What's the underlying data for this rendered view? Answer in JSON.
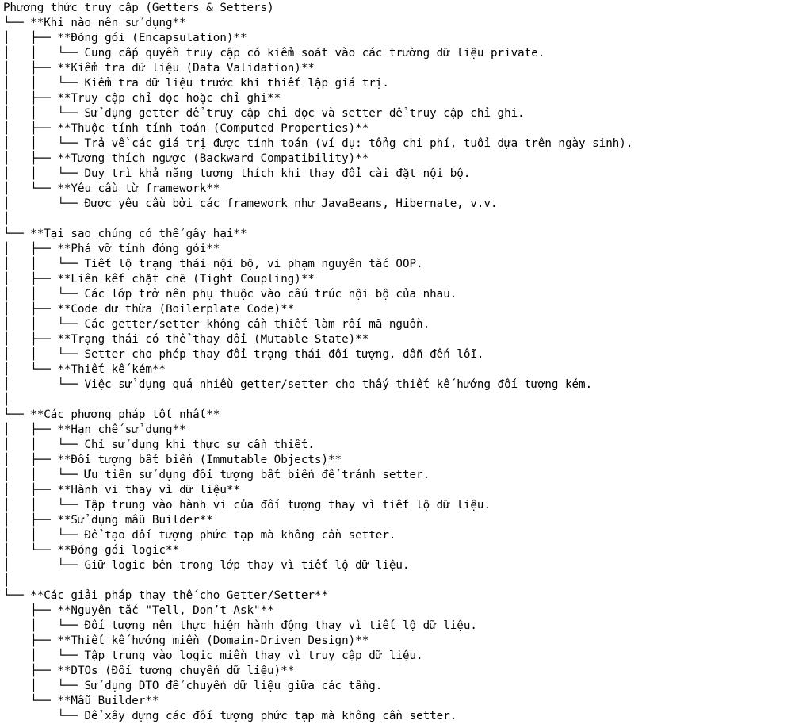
{
  "title": "Phương thức truy cập (Getters & Setters)",
  "sections": [
    {
      "heading": "**Khi nào nên sử dụng**",
      "items": [
        {
          "title": "**Đóng gói (Encapsulation)**",
          "detail": "Cung cấp quyền truy cập có kiểm soát vào các trường dữ liệu private."
        },
        {
          "title": "**Kiểm tra dữ liệu (Data Validation)**",
          "detail": "Kiểm tra dữ liệu trước khi thiết lập giá trị."
        },
        {
          "title": "**Truy cập chỉ đọc hoặc chỉ ghi**",
          "detail": "Sử dụng getter để truy cập chỉ đọc và setter để truy cập chỉ ghi."
        },
        {
          "title": "**Thuộc tính tính toán (Computed Properties)**",
          "detail": "Trả về các giá trị được tính toán (ví dụ: tổng chi phí, tuổi dựa trên ngày sinh)."
        },
        {
          "title": "**Tương thích ngược (Backward Compatibility)**",
          "detail": "Duy trì khả năng tương thích khi thay đổi cài đặt nội bộ."
        },
        {
          "title": "**Yêu cầu từ framework**",
          "detail": "Được yêu cầu bởi các framework như JavaBeans, Hibernate, v.v."
        }
      ]
    },
    {
      "heading": "**Tại sao chúng có thể gây hại**",
      "items": [
        {
          "title": "**Phá vỡ tính đóng gói**",
          "detail": "Tiết lộ trạng thái nội bộ, vi phạm nguyên tắc OOP."
        },
        {
          "title": "**Liên kết chặt chẽ (Tight Coupling)**",
          "detail": "Các lớp trở nên phụ thuộc vào cấu trúc nội bộ của nhau."
        },
        {
          "title": "**Code dư thừa (Boilerplate Code)**",
          "detail": "Các getter/setter không cần thiết làm rối mã nguồn."
        },
        {
          "title": "**Trạng thái có thể thay đổi (Mutable State)**",
          "detail": "Setter cho phép thay đổi trạng thái đối tượng, dẫn đến lỗi."
        },
        {
          "title": "**Thiết kế kém**",
          "detail": "Việc sử dụng quá nhiều getter/setter cho thấy thiết kế hướng đối tượng kém."
        }
      ]
    },
    {
      "heading": "**Các phương pháp tốt nhất**",
      "items": [
        {
          "title": "**Hạn chế sử dụng**",
          "detail": "Chỉ sử dụng khi thực sự cần thiết."
        },
        {
          "title": "**Đối tượng bất biến (Immutable Objects)**",
          "detail": "Ưu tiên sử dụng đối tượng bất biến để tránh setter."
        },
        {
          "title": "**Hành vi thay vì dữ liệu**",
          "detail": "Tập trung vào hành vi của đối tượng thay vì tiết lộ dữ liệu."
        },
        {
          "title": "**Sử dụng mẫu Builder**",
          "detail": "Để tạo đối tượng phức tạp mà không cần setter."
        },
        {
          "title": "**Đóng gói logic**",
          "detail": "Giữ logic bên trong lớp thay vì tiết lộ dữ liệu."
        }
      ]
    },
    {
      "heading": "**Các giải pháp thay thế cho Getter/Setter**",
      "items": [
        {
          "title": "**Nguyên tắc \"Tell, Don’t Ask\"**",
          "detail": "Đối tượng nên thực hiện hành động thay vì tiết lộ dữ liệu."
        },
        {
          "title": "**Thiết kế hướng miền (Domain-Driven Design)**",
          "detail": "Tập trung vào logic miền thay vì truy cập dữ liệu."
        },
        {
          "title": "**DTOs (Đối tượng chuyển dữ liệu)**",
          "detail": "Sử dụng DTO để chuyển dữ liệu giữa các tầng."
        },
        {
          "title": "**Mẫu Builder**",
          "detail": "Để xây dựng các đối tượng phức tạp mà không cần setter."
        }
      ]
    }
  ]
}
